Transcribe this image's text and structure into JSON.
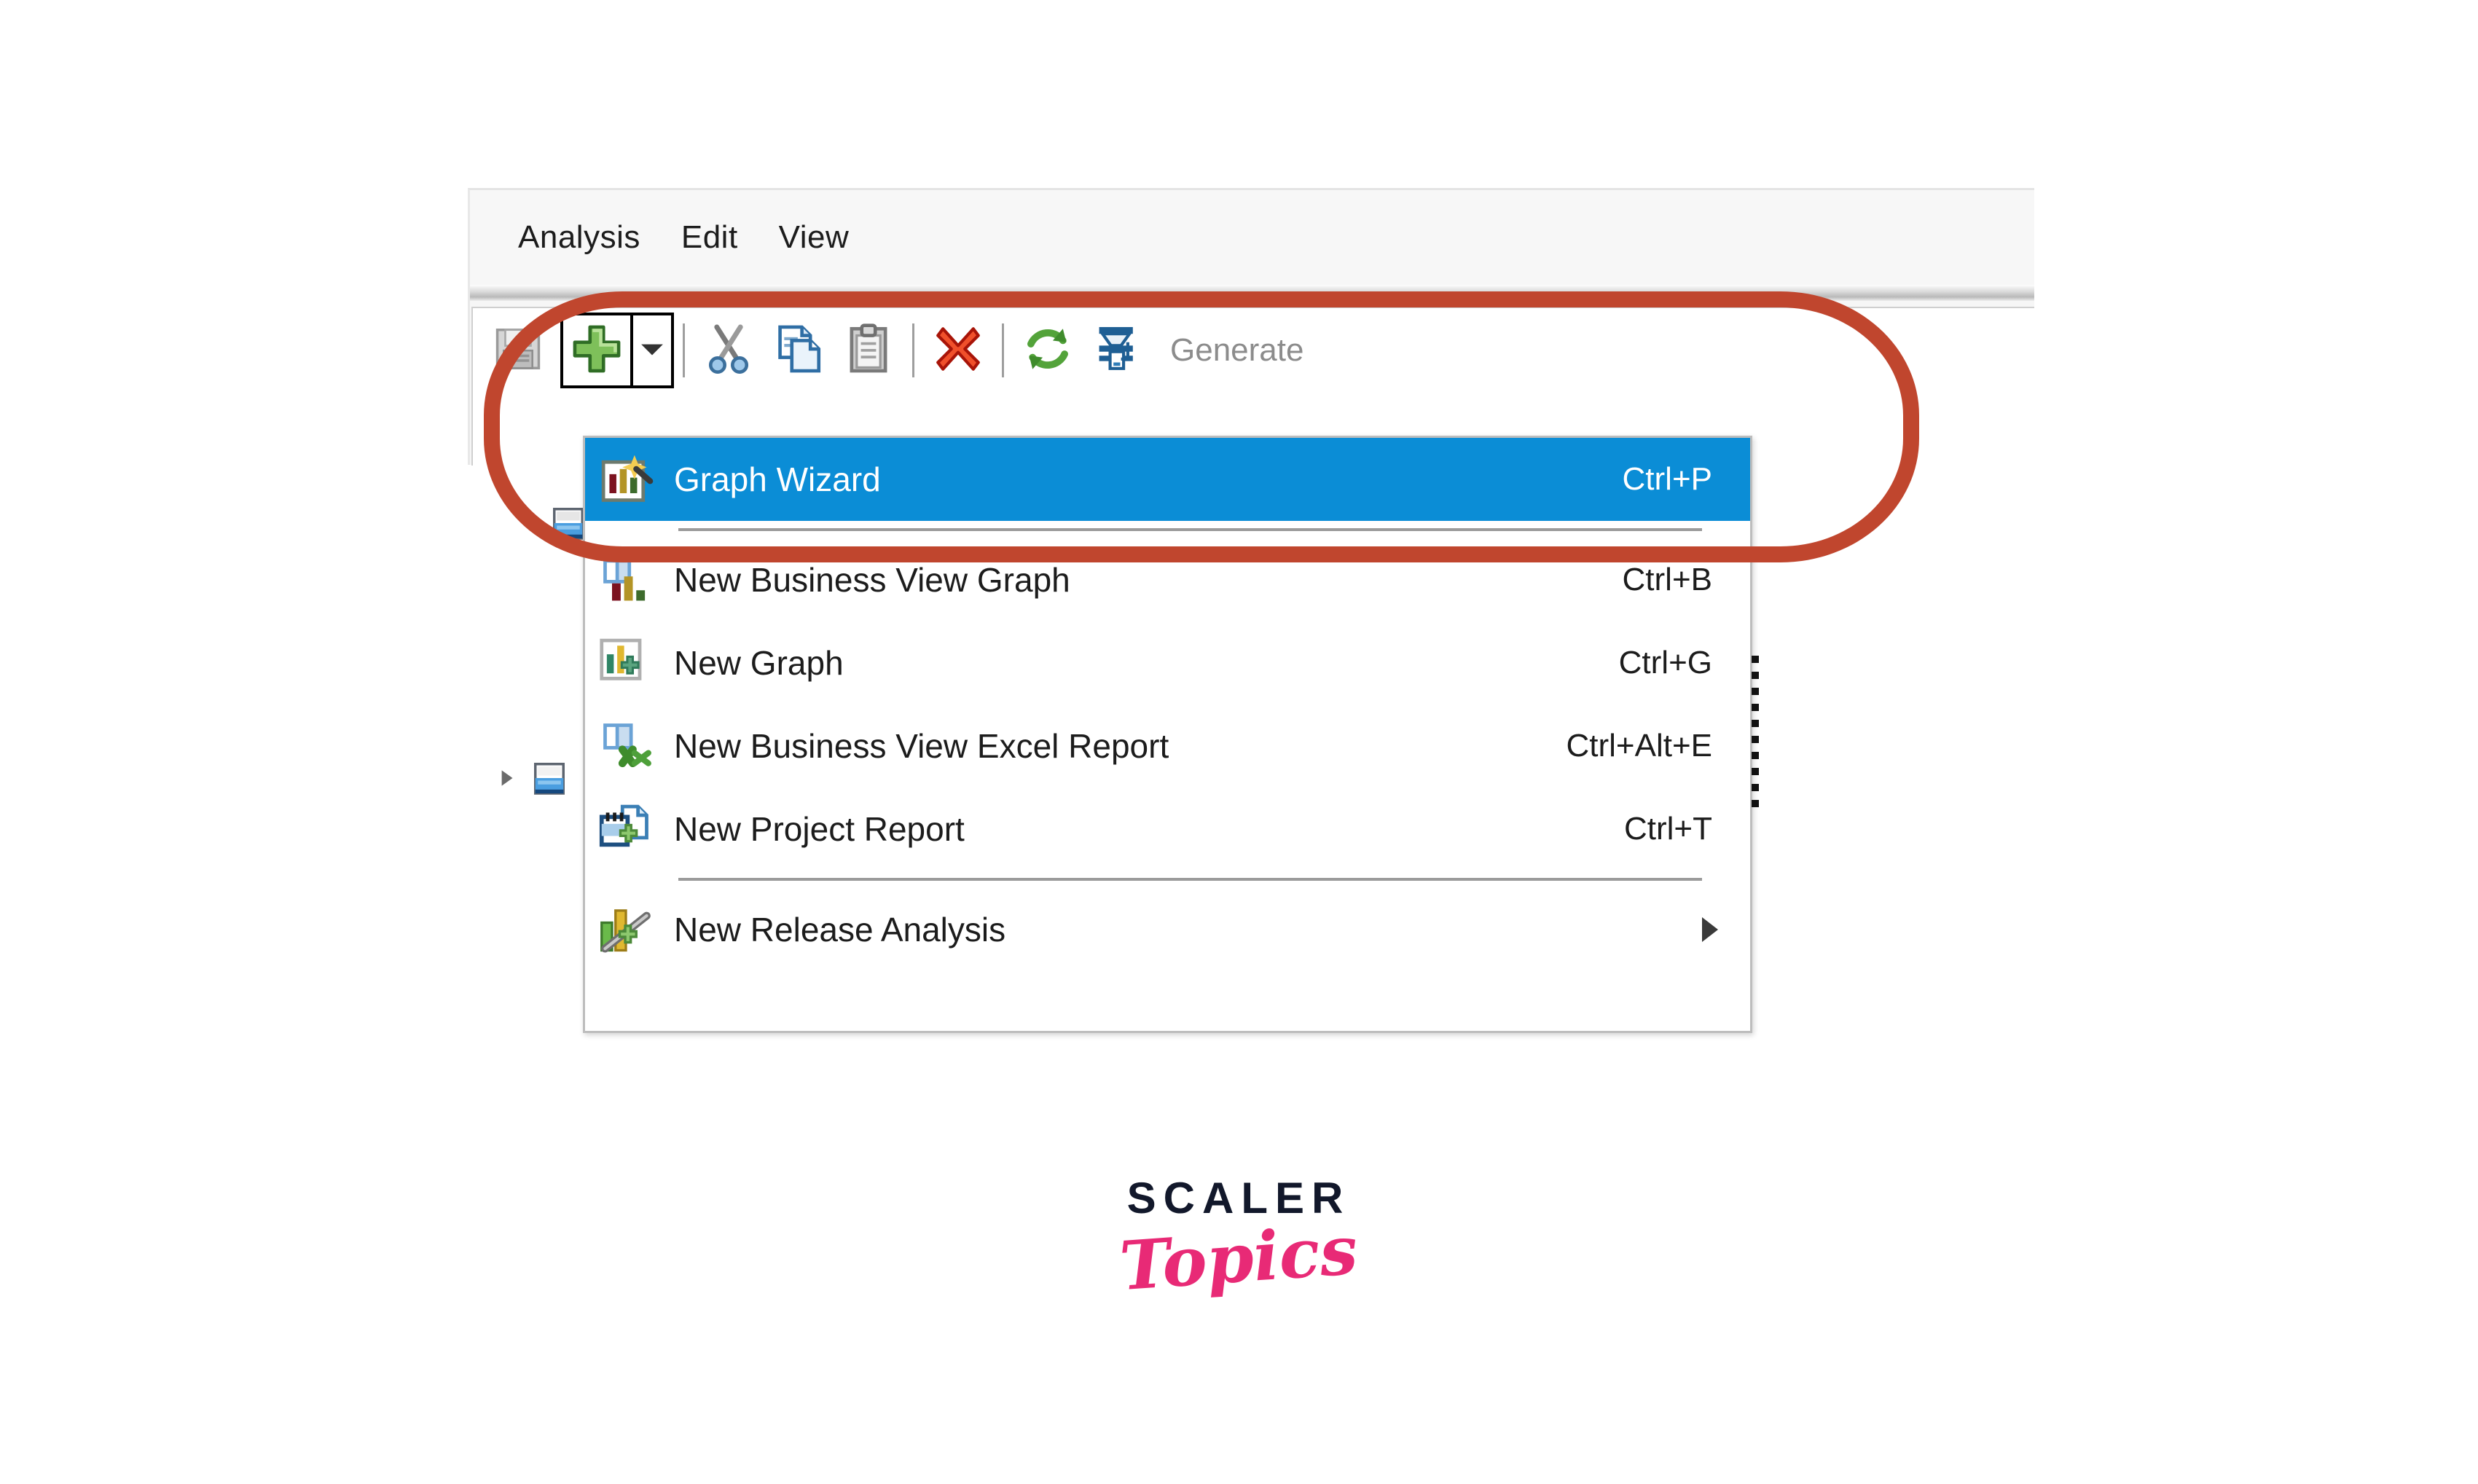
{
  "window": {
    "menubar": {
      "items": [
        {
          "label": "Analysis",
          "name": "menubar-item-analysis"
        },
        {
          "label": "Edit",
          "name": "menubar-item-edit"
        },
        {
          "label": "View",
          "name": "menubar-item-view"
        }
      ]
    },
    "toolbar": {
      "buttons": [
        {
          "icon": "save-disk-icon",
          "label": "",
          "state": "disabled"
        },
        {
          "icon": "add-plus-icon",
          "label": "",
          "state": "active-split"
        },
        {
          "icon": "cut-scissors-icon",
          "label": ""
        },
        {
          "icon": "copy-pages-icon",
          "label": ""
        },
        {
          "icon": "paste-clipboard-icon",
          "label": ""
        },
        {
          "icon": "delete-x-icon",
          "label": ""
        },
        {
          "icon": "refresh-arrows-icon",
          "label": ""
        },
        {
          "icon": "generate-funnel-icon",
          "label": ""
        }
      ],
      "generate_label": "Generate"
    }
  },
  "dropdown": {
    "items": [
      {
        "label": "Graph Wizard",
        "shortcut": "Ctrl+P",
        "icon": "graph-wizard-icon",
        "selected": true,
        "submenu": false
      },
      {
        "label": "New Business View Graph",
        "shortcut": "Ctrl+B",
        "icon": "business-view-graph-icon",
        "selected": false,
        "submenu": false
      },
      {
        "label": "New Graph",
        "shortcut": "Ctrl+G",
        "icon": "new-graph-icon",
        "selected": false,
        "submenu": false
      },
      {
        "label": "New Business View Excel Report",
        "shortcut": "Ctrl+Alt+E",
        "icon": "business-view-excel-report-icon",
        "selected": false,
        "submenu": false
      },
      {
        "label": "New Project Report",
        "shortcut": "Ctrl+T",
        "icon": "project-report-icon",
        "selected": false,
        "submenu": false
      },
      {
        "label": "New Release Analysis",
        "shortcut": "",
        "icon": "release-analysis-icon",
        "selected": false,
        "submenu": true
      }
    ]
  },
  "annotation": {
    "shape": "oval",
    "color": "#c0462e"
  },
  "logo": {
    "primary": "SCALER",
    "secondary": "Topics",
    "primary_color": "#12182b",
    "secondary_color": "#e82a76"
  },
  "colors": {
    "selection_blue": "#0b8dd6",
    "window_background": "#f6f6f6",
    "toolbar_background": "#ffffff",
    "menu_border": "#bdbdbd"
  }
}
